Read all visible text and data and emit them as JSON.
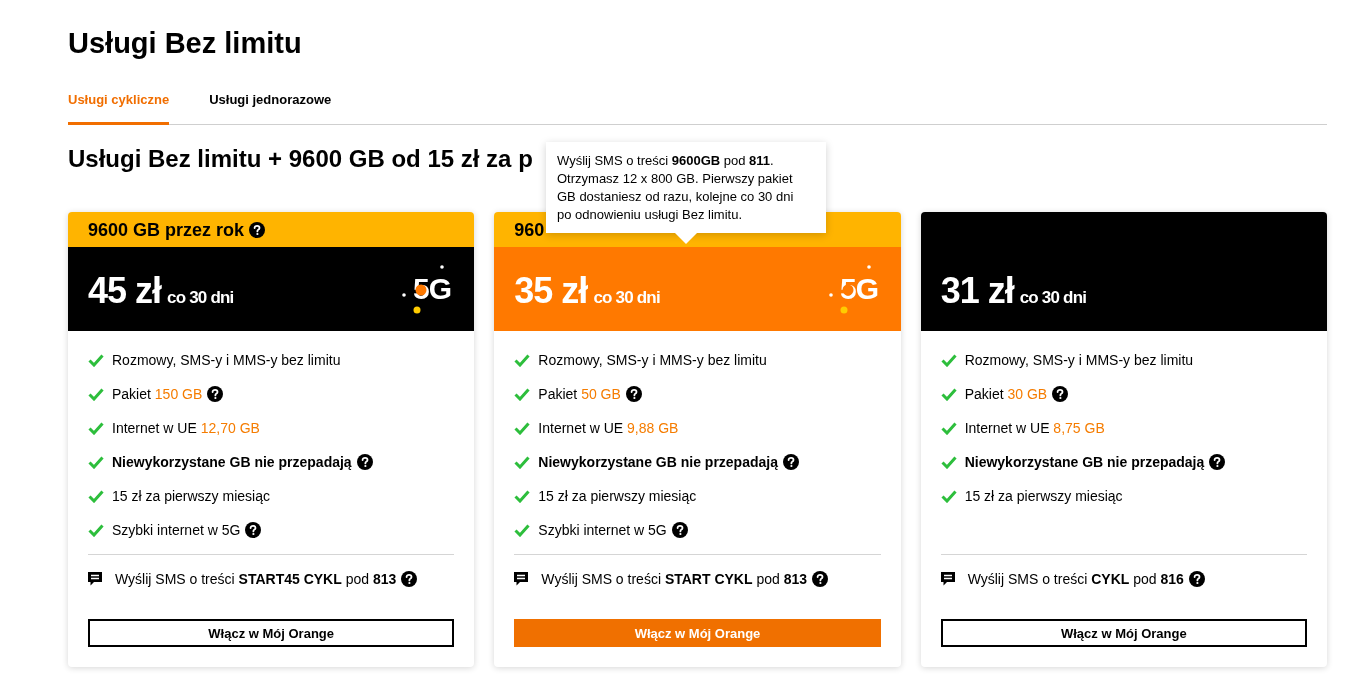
{
  "page": {
    "title": "Usługi Bez limitu"
  },
  "tabs": [
    {
      "label": "Usługi cykliczne",
      "selected": true
    },
    {
      "label": "Usługi jednorazowe",
      "selected": false
    }
  ],
  "section_title": "Usługi Bez limitu + 9600 GB od 15 zł za p",
  "tooltip": {
    "text": "Wyślij SMS o treści **9600GB** pod **811**. Otrzymasz 12 x 800 GB. Pierwszy pakiet GB dostaniesz od razu, kolejne co 30 dni po odnowieniu usługi Bez limitu."
  },
  "cards": [
    {
      "featured": false,
      "badge": {
        "text": "9600 GB przez rok",
        "help": true
      },
      "price": "45 zł",
      "period": "co 30 dni",
      "network": "5G",
      "features": [
        {
          "text": "Rozmowy, SMS-y i MMS-y bez limitu",
          "strong": false,
          "help": false
        },
        {
          "text": "Pakiet",
          "highlight": "150 GB",
          "strong": false,
          "help": true
        },
        {
          "text": "Internet w UE",
          "highlight": "12,70 GB",
          "strong": false,
          "help": false
        },
        {
          "text": "Niewykorzystane GB nie przepadają",
          "strong": true,
          "help": true
        },
        {
          "text": "15 zł za pierwszy miesiąc",
          "strong": false,
          "help": false
        },
        {
          "text": "Szybki internet w 5G",
          "strong": false,
          "help": true
        }
      ],
      "sms": {
        "text": "Wyślij SMS o treści **START45 CYKL** pod **813**",
        "help": true
      },
      "button": {
        "label": "Włącz w Mój Orange",
        "filled": false
      }
    },
    {
      "featured": true,
      "badge": {
        "text": "960"
      },
      "price": "35 zł",
      "period": "co 30 dni",
      "network": "5G",
      "features": [
        {
          "text": "Rozmowy, SMS-y i MMS-y bez limitu",
          "strong": false,
          "help": false
        },
        {
          "text": "Pakiet",
          "highlight": "50 GB",
          "strong": false,
          "help": true
        },
        {
          "text": "Internet w UE",
          "highlight": "9,88 GB",
          "strong": false,
          "help": false
        },
        {
          "text": "Niewykorzystane GB nie przepadają",
          "strong": true,
          "help": true
        },
        {
          "text": "15 zł za pierwszy miesiąc",
          "strong": false,
          "help": false
        },
        {
          "text": "Szybki internet w 5G",
          "strong": false,
          "help": true
        }
      ],
      "sms": {
        "text": "Wyślij SMS o treści **START CYKL** pod **813**",
        "help": true
      },
      "button": {
        "label": "Włącz w Mój Orange",
        "filled": true
      }
    },
    {
      "featured": false,
      "price": "31 zł",
      "period": "co 30 dni",
      "features": [
        {
          "text": "Rozmowy, SMS-y i MMS-y bez limitu",
          "strong": false,
          "help": false
        },
        {
          "text": "Pakiet",
          "highlight": "30 GB",
          "strong": false,
          "help": true
        },
        {
          "text": "Internet w UE",
          "highlight": "8,75 GB",
          "strong": false,
          "help": false
        },
        {
          "text": "Niewykorzystane GB nie przepadają",
          "strong": true,
          "help": true
        },
        {
          "text": "15 zł za pierwszy miesiąc",
          "strong": false,
          "help": false
        }
      ],
      "sms": {
        "text": "Wyślij SMS o treści **CYKL** pod **816**",
        "help": true
      },
      "button": {
        "label": "Włącz w Mój Orange",
        "filled": false
      }
    }
  ]
}
